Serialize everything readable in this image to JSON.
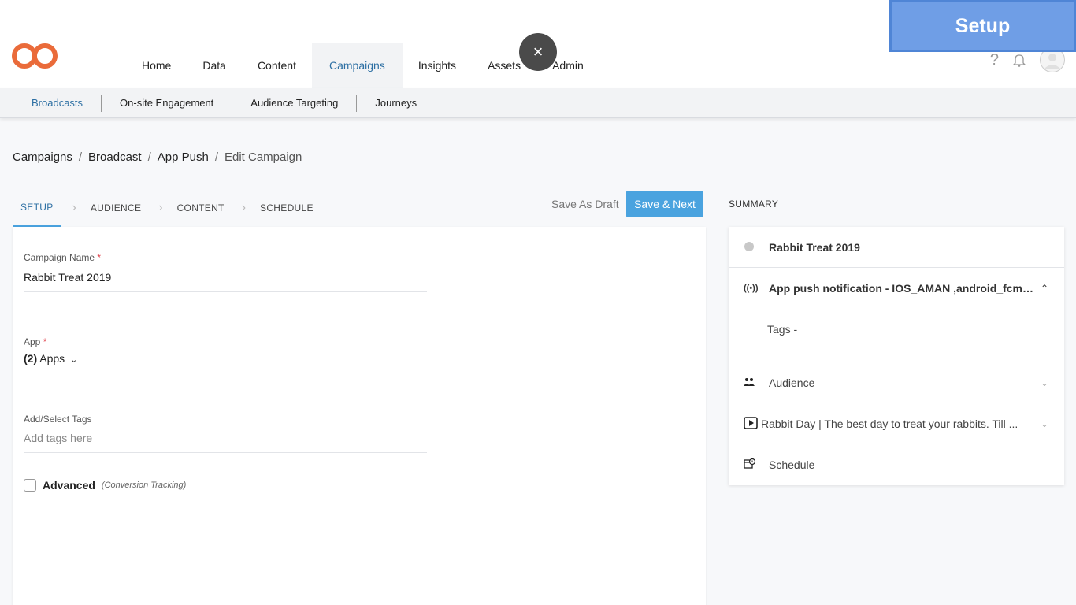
{
  "nav": {
    "items": [
      "Home",
      "Data",
      "Content",
      "Campaigns",
      "Insights",
      "Assets",
      "Admin"
    ],
    "active": "Campaigns"
  },
  "close_button": "×",
  "setup_banner": "Setup",
  "help_icon": "?",
  "subnav": {
    "items": [
      "Broadcasts",
      "On-site Engagement",
      "Audience Targeting",
      "Journeys"
    ],
    "active": "Broadcasts"
  },
  "breadcrumb": {
    "items": [
      "Campaigns",
      "Broadcast",
      "App Push",
      "Edit Campaign"
    ],
    "separator": "/"
  },
  "steps": {
    "items": [
      "SETUP",
      "AUDIENCE",
      "CONTENT",
      "SCHEDULE"
    ],
    "active": "SETUP"
  },
  "actions": {
    "save_draft": "Save As Draft",
    "save_next": "Save & Next"
  },
  "form": {
    "campaign_name_label": "Campaign Name",
    "campaign_name_value": "Rabbit Treat 2019",
    "app_label": "App",
    "app_count": "(2)",
    "app_value": "Apps",
    "tags_label": "Add/Select Tags",
    "tags_placeholder": "Add tags here",
    "advanced_label": "Advanced",
    "advanced_sub": "(Conversion Tracking)",
    "required_mark": "*"
  },
  "summary": {
    "title": "SUMMARY",
    "campaign_name": "Rabbit Treat 2019",
    "channel": "App push notification - IOS_AMAN ,android_fcm_...",
    "tags": "Tags -",
    "audience": "Audience",
    "content": "Rabbit Day | The best day to treat your rabbits. Till ...",
    "schedule": "Schedule"
  },
  "colors": {
    "accent": "#4aa3df",
    "active_text": "#2d6fa3",
    "logo": "#ea6b3a",
    "banner": "#6f9ee6",
    "required": "#e0424b"
  }
}
